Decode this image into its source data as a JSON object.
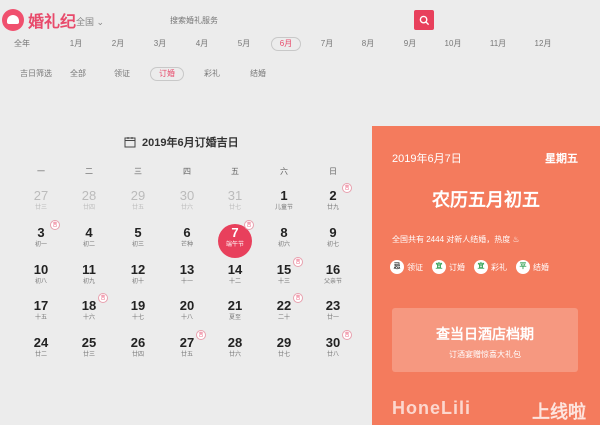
{
  "header": {
    "logo_text": "婚礼纪",
    "city": "全国",
    "search_placeholder": "搜索婚礼服务",
    "accent": "#e8405c"
  },
  "months": [
    "全年",
    "1月",
    "2月",
    "3月",
    "4月",
    "5月",
    "6月",
    "7月",
    "8月",
    "9月",
    "10月",
    "11月",
    "12月"
  ],
  "active_month": "6月",
  "categories": [
    "吉日筛选",
    "全部",
    "领证",
    "订婚",
    "彩礼",
    "结婚"
  ],
  "active_category": "订婚",
  "calendar": {
    "title": "2019年6月订婚吉日",
    "weekdays": [
      "一",
      "二",
      "三",
      "四",
      "五",
      "六",
      "日"
    ],
    "weeks": [
      [
        {
          "d": "27",
          "s": "廿三",
          "o": true
        },
        {
          "d": "28",
          "s": "廿四",
          "o": true
        },
        {
          "d": "29",
          "s": "廿五",
          "o": true
        },
        {
          "d": "30",
          "s": "廿六",
          "o": true
        },
        {
          "d": "31",
          "s": "廿七",
          "o": true
        },
        {
          "d": "1",
          "s": "儿童节"
        },
        {
          "d": "2",
          "s": "廿九",
          "b": "吉"
        }
      ],
      [
        {
          "d": "3",
          "s": "初一",
          "b": "吉"
        },
        {
          "d": "4",
          "s": "初二"
        },
        {
          "d": "5",
          "s": "初三"
        },
        {
          "d": "6",
          "s": "芒种"
        },
        {
          "d": "7",
          "s": "端午节",
          "t": true,
          "b": "吉"
        },
        {
          "d": "8",
          "s": "初六"
        },
        {
          "d": "9",
          "s": "初七"
        }
      ],
      [
        {
          "d": "10",
          "s": "初八"
        },
        {
          "d": "11",
          "s": "初九"
        },
        {
          "d": "12",
          "s": "初十"
        },
        {
          "d": "13",
          "s": "十一"
        },
        {
          "d": "14",
          "s": "十二"
        },
        {
          "d": "15",
          "s": "十三",
          "b": "吉"
        },
        {
          "d": "16",
          "s": "父亲节"
        }
      ],
      [
        {
          "d": "17",
          "s": "十五"
        },
        {
          "d": "18",
          "s": "十六",
          "b": "吉"
        },
        {
          "d": "19",
          "s": "十七"
        },
        {
          "d": "20",
          "s": "十八"
        },
        {
          "d": "21",
          "s": "夏至"
        },
        {
          "d": "22",
          "s": "二十",
          "b": "吉"
        },
        {
          "d": "23",
          "s": "廿一"
        }
      ],
      [
        {
          "d": "24",
          "s": "廿二"
        },
        {
          "d": "25",
          "s": "廿三"
        },
        {
          "d": "26",
          "s": "廿四"
        },
        {
          "d": "27",
          "s": "廿五",
          "b": "吉"
        },
        {
          "d": "28",
          "s": "廿六"
        },
        {
          "d": "29",
          "s": "廿七"
        },
        {
          "d": "30",
          "s": "廿八",
          "b": "吉"
        }
      ]
    ]
  },
  "panel": {
    "date": "2019年6月7日",
    "weekday": "星期五",
    "lunar": "农历五月初五",
    "stats": "全国共有 2444 对新人结婚，热度",
    "yi": [
      {
        "mark": "忌",
        "label": "领证",
        "ji": true
      },
      {
        "mark": "宜",
        "label": "订婚"
      },
      {
        "mark": "宜",
        "label": "彩礼"
      },
      {
        "mark": "平",
        "label": "结婚"
      }
    ],
    "promo_title": "查当日酒店档期",
    "promo_sub": "订酒宴赠惊喜大礼包",
    "footer_left": "HoneLili",
    "footer_right": "上线啦",
    "bg_color": "#f47b5d"
  }
}
